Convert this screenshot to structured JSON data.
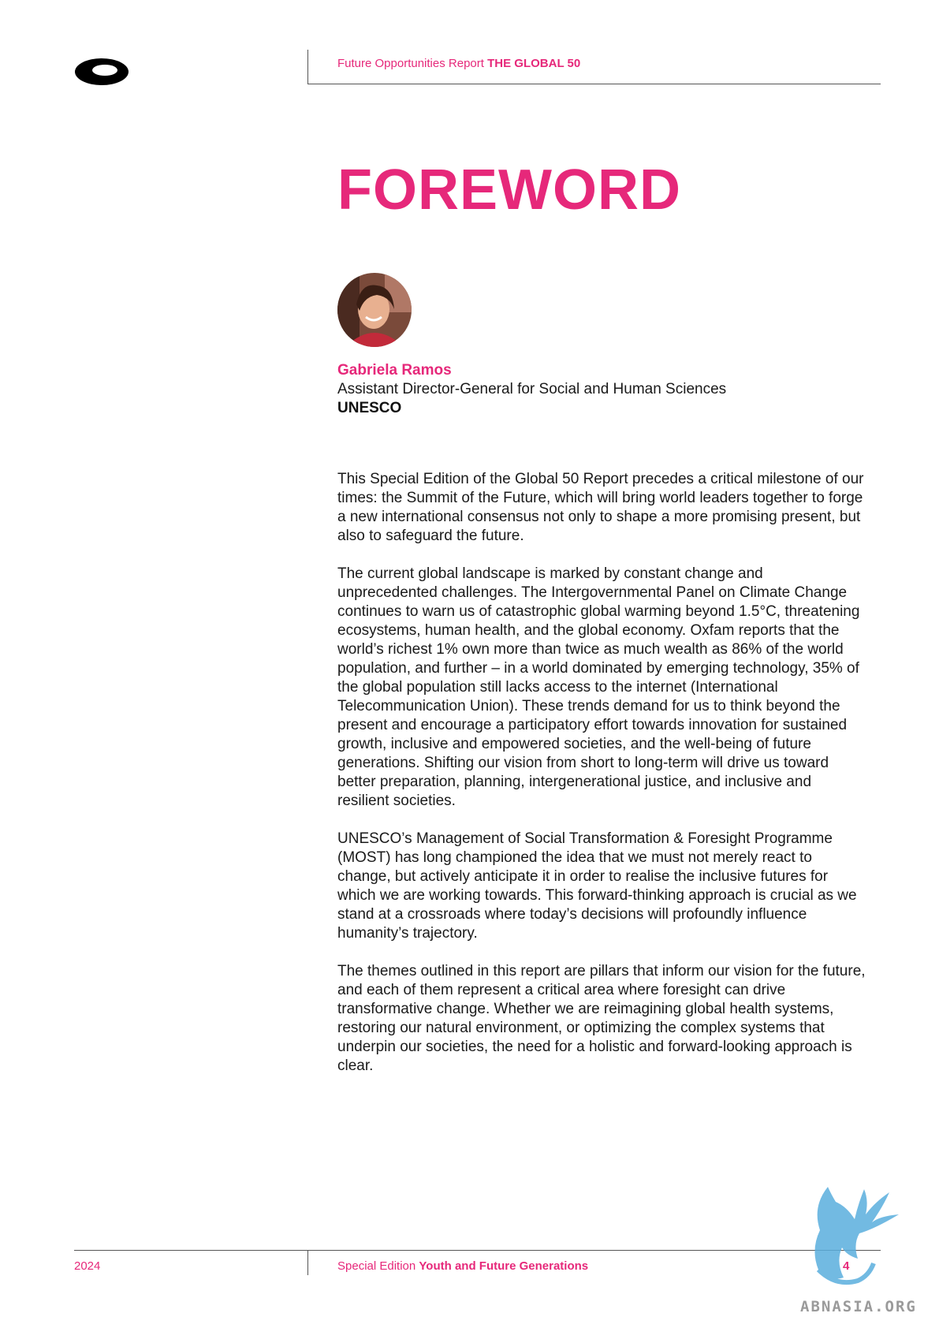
{
  "header": {
    "report_label": "Future Opportunities Report",
    "report_title": "THE GLOBAL 50"
  },
  "title": "FOREWORD",
  "author": {
    "name": "Gabriela Ramos",
    "role": "Assistant Director-General for Social and Human Sciences",
    "organization": "UNESCO"
  },
  "paragraphs": [
    "This Special Edition of the Global 50 Report precedes a critical milestone of our times: the Summit of the Future, which will bring world leaders together to forge a new international consensus not only to shape a more promising present, but also to safeguard the future.",
    "The current global landscape is marked by constant change and unprecedented challenges. The Intergovernmental Panel on Climate Change continues to warn us of catastrophic global warming beyond 1.5°C, threatening ecosystems, human health, and the global economy. Oxfam reports that the world’s richest 1% own more than twice as much wealth as 86% of the world population, and further – in a world dominated by emerging technology, 35% of the global population still lacks access to the internet (International Telecommunication Union). These trends demand for us to think beyond the present and encourage a participatory effort towards innovation for sustained growth, inclusive and empowered societies, and the well-being of future generations. Shifting our vision from short to long-term will drive us toward better preparation, planning, intergenerational justice, and inclusive and resilient societies.",
    "UNESCO’s Management of Social Transformation & Foresight Programme (MOST) has long championed the idea that we must not merely react to change, but actively anticipate it in order to realise the inclusive futures for which we are working towards. This forward-thinking approach is crucial as we stand at a crossroads where today’s decisions will profoundly influence humanity’s trajectory.",
    "The themes outlined in this report are pillars that inform our vision for the future, and each of them represent a critical area where foresight can drive transformative change. Whether we are reimagining global health systems, restoring our natural environment, or optimizing the complex systems that underpin our societies, the need for a holistic and forward-looking approach is clear."
  ],
  "footer": {
    "year": "2024",
    "edition_label": "Special Edition",
    "edition_title": "Youth and Future Generations",
    "page_number": "4"
  },
  "watermark": "ABNASIA.ORG",
  "colors": {
    "accent": "#e6287a",
    "text": "#1a1a1a",
    "rule": "#555555",
    "watermark": "#5aaede"
  },
  "icons": {
    "logo": "ring-logo-icon",
    "watermark": "griffin-watermark-icon"
  }
}
